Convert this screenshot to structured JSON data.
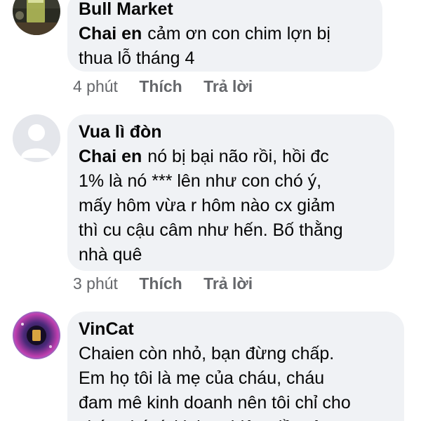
{
  "comments": [
    {
      "author": "Bull Market",
      "mention": "Chai en",
      "lines": [
        "cảm ơn con chim lợn bị",
        "thua lỗ tháng 4"
      ],
      "time": "4 phút",
      "like_label": "Thích",
      "reply_label": "Trả lời",
      "avatar_icon": "profile-photo-glass"
    },
    {
      "author": "Vua lì đòn",
      "mention": "Chai en",
      "lines": [
        "nó bị bại não rồi, hồi đc",
        "1% là nó *** lên như con chó ý,",
        "mấy hôm vừa r hôm nào cx giảm",
        "thì cu cậu câm như hến. Bố thằng",
        "nhà quê"
      ],
      "time": "3 phút",
      "like_label": "Thích",
      "reply_label": "Trả lời",
      "avatar_icon": "default-user-silhouette"
    },
    {
      "author": "VinCat",
      "lines": [
        "Chaien còn nhỏ, bạn đừng chấp.",
        "Em họ tôi là mẹ của cháu, cháu",
        "đam mê kinh doanh nên tôi chỉ cho",
        "cháu chút ít kinh nghiệm tiền tệ"
      ],
      "avatar_icon": "purple-galaxy-avatar"
    }
  ],
  "colors": {
    "bubble_bg": "#f0f2f5",
    "text": "#050505",
    "meta_text": "#65676b"
  }
}
